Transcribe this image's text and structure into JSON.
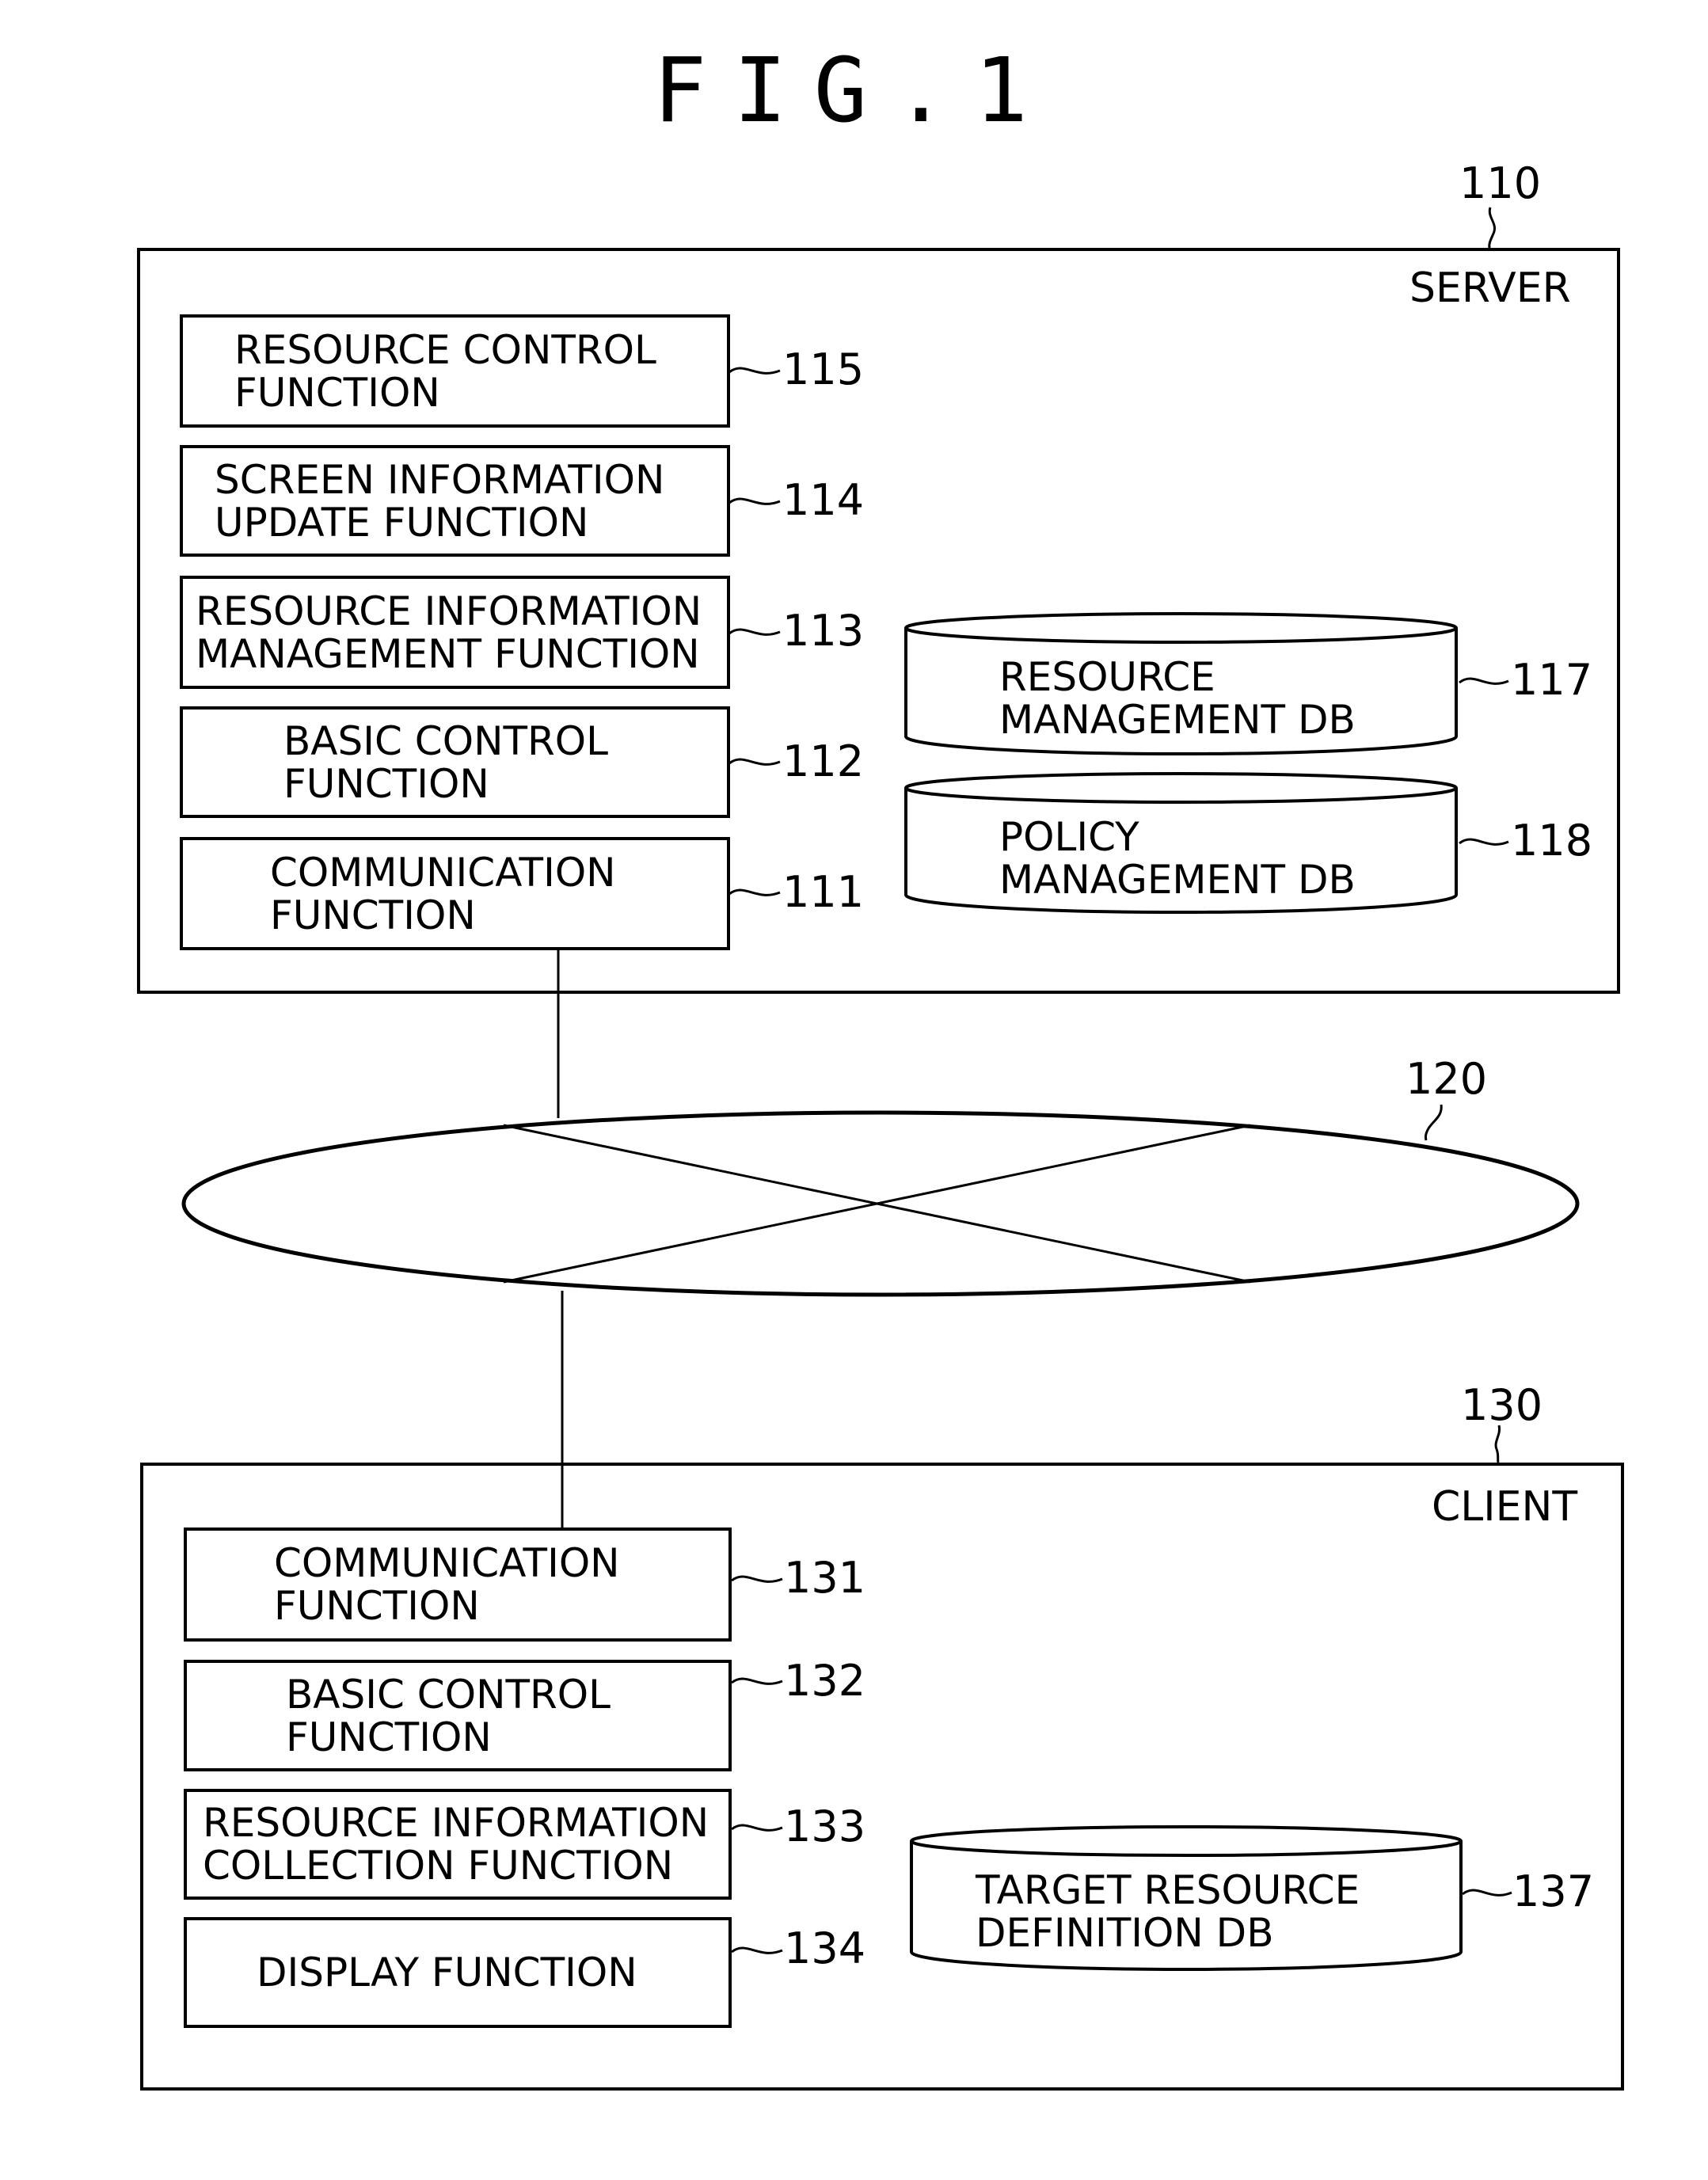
{
  "figure": {
    "title": "FIG.1"
  },
  "server": {
    "ref": "110",
    "label": "SERVER",
    "functions": [
      {
        "ref": "115",
        "lines": [
          "RESOURCE CONTROL",
          "FUNCTION"
        ]
      },
      {
        "ref": "114",
        "lines": [
          "SCREEN INFORMATION",
          "UPDATE FUNCTION"
        ]
      },
      {
        "ref": "113",
        "lines": [
          "RESOURCE INFORMATION",
          "MANAGEMENT FUNCTION"
        ]
      },
      {
        "ref": "112",
        "lines": [
          "BASIC CONTROL",
          "FUNCTION"
        ]
      },
      {
        "ref": "111",
        "lines": [
          "COMMUNICATION",
          "FUNCTION"
        ]
      }
    ],
    "databases": [
      {
        "ref": "117",
        "lines": [
          "RESOURCE",
          "MANAGEMENT DB"
        ]
      },
      {
        "ref": "118",
        "lines": [
          "POLICY",
          "MANAGEMENT DB"
        ]
      }
    ]
  },
  "network": {
    "ref": "120"
  },
  "client": {
    "ref": "130",
    "label": "CLIENT",
    "functions": [
      {
        "ref": "131",
        "lines": [
          "COMMUNICATION",
          "FUNCTION"
        ]
      },
      {
        "ref": "132",
        "lines": [
          "BASIC CONTROL",
          "FUNCTION"
        ]
      },
      {
        "ref": "133",
        "lines": [
          "RESOURCE INFORMATION",
          "COLLECTION FUNCTION"
        ]
      },
      {
        "ref": "134",
        "lines": [
          "DISPLAY FUNCTION"
        ]
      }
    ],
    "databases": [
      {
        "ref": "137",
        "lines": [
          "TARGET RESOURCE",
          "DEFINITION DB"
        ]
      }
    ]
  }
}
